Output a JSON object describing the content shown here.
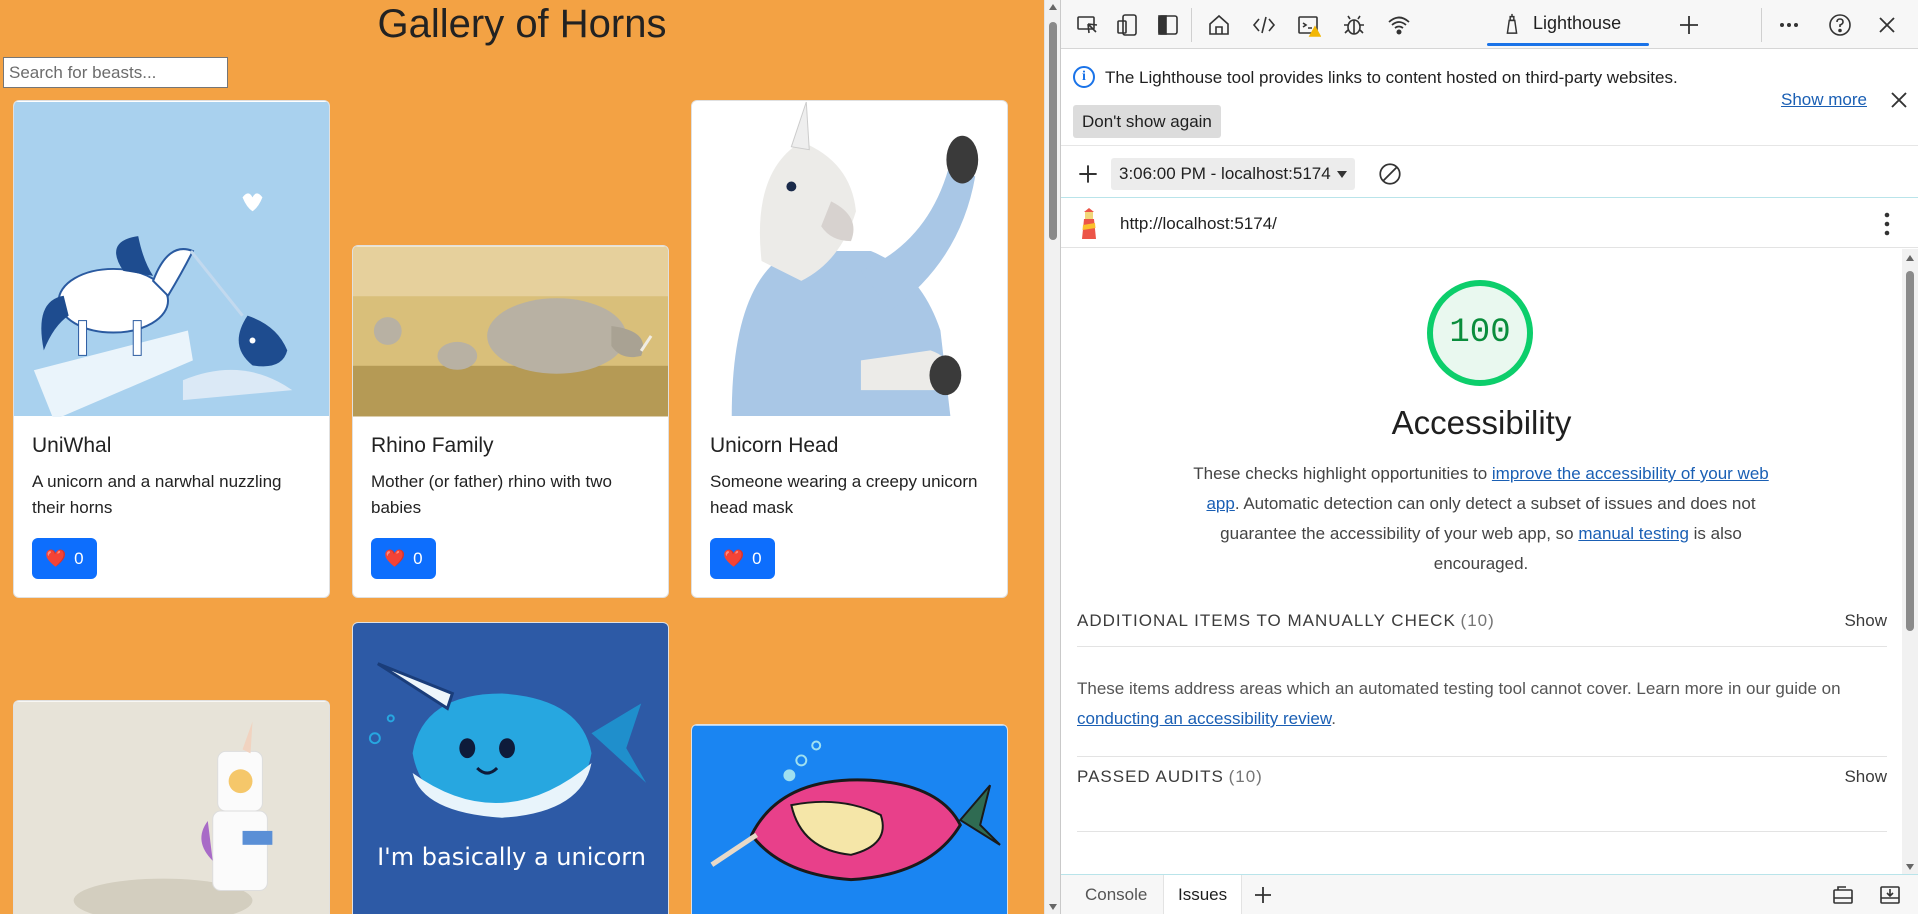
{
  "gallery": {
    "title": "Gallery of Horns",
    "search_placeholder": "Search for beasts...",
    "cards": [
      {
        "title": "UniWhal",
        "description": "A unicorn and a narwhal nuzzling their horns",
        "likes": "0"
      },
      {
        "title": "Rhino Family",
        "description": "Mother (or father) rhino with two babies",
        "likes": "0"
      },
      {
        "title": "Unicorn Head",
        "description": "Someone wearing a creepy unicorn head mask",
        "likes": "0"
      },
      {
        "title": "",
        "description": "",
        "likes": ""
      },
      {
        "title": "",
        "description": "",
        "likes": "",
        "image_caption": "I'm basically a unicorn"
      },
      {
        "title": "",
        "description": "",
        "likes": ""
      }
    ],
    "heart_icon": "❤️"
  },
  "devtools": {
    "toolbar": {
      "icons": [
        "inspect-icon",
        "device-emulation-icon",
        "dock-icon",
        "welcome-home-icon",
        "elements-icon",
        "console-icon",
        "sources-debug-icon",
        "network-icon",
        "lighthouse-icon",
        "add-tab-icon",
        "more-icon",
        "help-icon",
        "close-icon"
      ],
      "active_tab": "Lighthouse"
    },
    "info_bar": {
      "message": "The Lighthouse tool provides links to content hosted on third-party websites.",
      "show_more": "Show more",
      "dont_show": "Don't show again"
    },
    "report_selector": "3:06:00 PM - localhost:5174",
    "url": "http://localhost:5174/",
    "report": {
      "score": "100",
      "category_title": "Accessibility",
      "desc_part1": "These checks highlight opportunities to ",
      "desc_link1": "improve the accessibility of your web app",
      "desc_part2": ". Automatic detection can only detect a subset of issues and does not guarantee the accessibility of your web app, so ",
      "desc_link2": "manual testing",
      "desc_part3": " is also encouraged.",
      "groups": [
        {
          "name": "ADDITIONAL ITEMS TO MANUALLY CHECK",
          "count": "(10)",
          "toggle": "Show"
        },
        {
          "name": "PASSED AUDITS",
          "count": "(10)",
          "toggle": "Show"
        }
      ],
      "manual_text": "These items address areas which an automated testing tool cannot cover. Learn more in our guide on ",
      "manual_link": "conducting an accessibility review",
      "manual_end": ".",
      "score_color": "#0cce6b"
    },
    "drawer": {
      "tabs": [
        "Console",
        "Issues"
      ],
      "active": "Issues"
    }
  },
  "colors": {
    "app_bg": "#f3a244",
    "button": "#0d6efd",
    "accent": "#1a73e8"
  }
}
